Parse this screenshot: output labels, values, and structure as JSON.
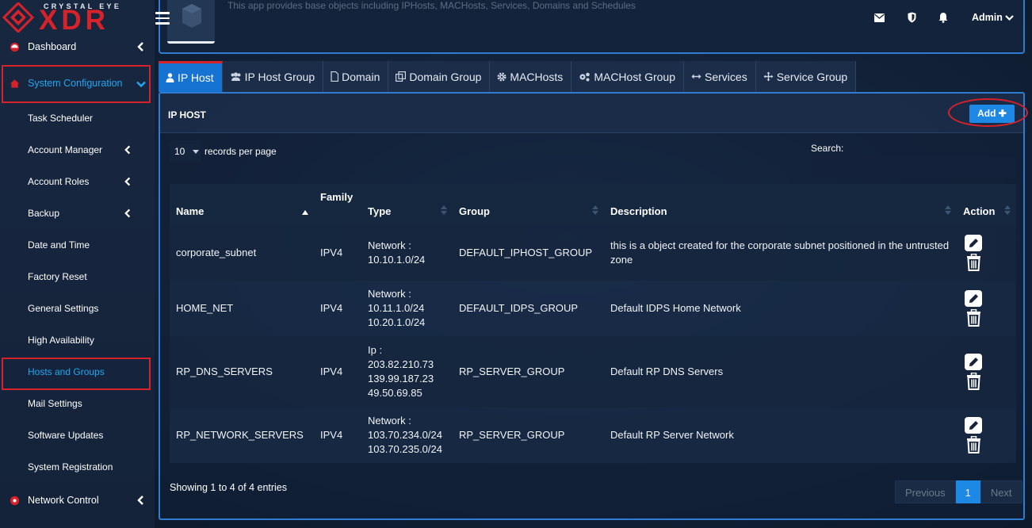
{
  "brand": {
    "tagline": "CRYSTAL EYE",
    "name": "XDR"
  },
  "app_description": "This app provides base objects including IPHosts, MACHosts, Services, Domains and Schedules",
  "header": {
    "user": "Admin"
  },
  "sidebar": {
    "top_items": [
      {
        "label": "Dashboard"
      },
      {
        "label": "System Configuration"
      },
      {
        "label": "Network Control"
      }
    ],
    "sub_items": [
      {
        "label": "Task Scheduler"
      },
      {
        "label": "Account Manager"
      },
      {
        "label": "Account Roles"
      },
      {
        "label": "Backup"
      },
      {
        "label": "Date and Time"
      },
      {
        "label": "Factory Reset"
      },
      {
        "label": "General Settings"
      },
      {
        "label": "High Availability"
      },
      {
        "label": "Hosts and Groups"
      },
      {
        "label": "Mail Settings"
      },
      {
        "label": "Software Updates"
      },
      {
        "label": "System Registration"
      }
    ]
  },
  "tabs": [
    {
      "label": "IP Host",
      "icon": "user-icon"
    },
    {
      "label": "IP Host Group",
      "icon": "users-icon"
    },
    {
      "label": "Domain",
      "icon": "file-icon"
    },
    {
      "label": "Domain Group",
      "icon": "copy-icon"
    },
    {
      "label": "MACHosts",
      "icon": "gear-icon"
    },
    {
      "label": "MACHost Group",
      "icon": "gears-icon"
    },
    {
      "label": "Services",
      "icon": "arrows-h-icon"
    },
    {
      "label": "Service Group",
      "icon": "move-icon"
    }
  ],
  "panel": {
    "title": "IP HOST",
    "add_label": "Add",
    "length_value": "10",
    "length_label": "records per page",
    "search_label": "Search:"
  },
  "table": {
    "headers": {
      "name": "Name",
      "family": "Family",
      "type": "Type",
      "group": "Group",
      "description": "Description",
      "action": "Action"
    },
    "rows": [
      {
        "name": "corporate_subnet",
        "family": "IPV4",
        "type_lines": [
          "Network :",
          "10.10.1.0/24"
        ],
        "group": "DEFAULT_IPHOST_GROUP",
        "description": "this is a object created for the corporate subnet positioned in the untrusted zone"
      },
      {
        "name": "HOME_NET",
        "family": "IPV4",
        "type_lines": [
          "Network :",
          "10.11.1.0/24",
          "10.20.1.0/24"
        ],
        "group": "DEFAULT_IDPS_GROUP",
        "description": "Default IDPS Home Network"
      },
      {
        "name": "RP_DNS_SERVERS",
        "family": "IPV4",
        "type_lines": [
          "Ip :",
          "203.82.210.73",
          "139.99.187.23",
          "49.50.69.85"
        ],
        "group": "RP_SERVER_GROUP",
        "description": "Default RP DNS Servers"
      },
      {
        "name": "RP_NETWORK_SERVERS",
        "family": "IPV4",
        "type_lines": [
          "Network :",
          "103.70.234.0/24",
          "103.70.235.0/24"
        ],
        "group": "RP_SERVER_GROUP",
        "description": "Default RP Server Network"
      }
    ]
  },
  "footer": {
    "info": "Showing 1 to 4 of 4 entries",
    "previous": "Previous",
    "page": "1",
    "next": "Next"
  },
  "colors": {
    "accent_red": "#d8222a",
    "accent_blue": "#1e88e5",
    "active_text": "#21a7f0"
  }
}
